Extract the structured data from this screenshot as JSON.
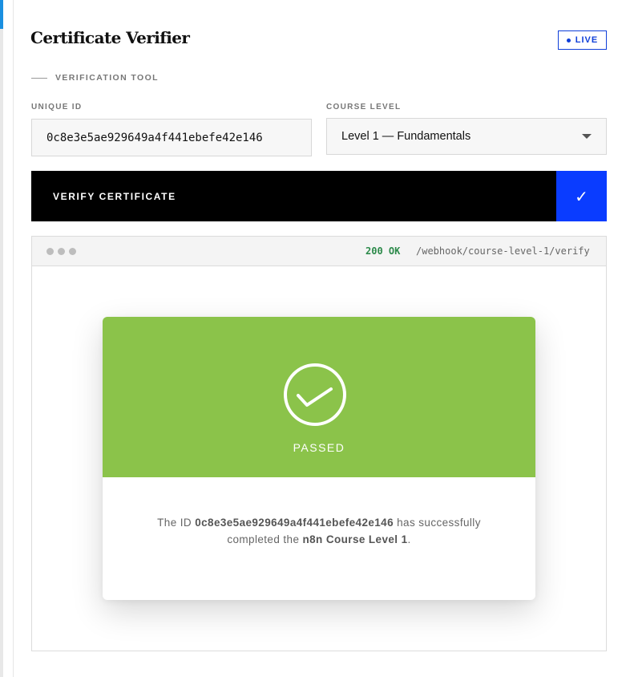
{
  "app": {
    "title": "Certificate Verifier",
    "live_badge": "LIVE",
    "subtitle": "VERIFICATION TOOL"
  },
  "form": {
    "unique_id_label": "UNIQUE ID",
    "unique_id_value": "0c8e3e5ae929649a4f441ebefe42e146",
    "course_level_label": "COURSE LEVEL",
    "course_level_selected": "Level 1 — Fundamentals"
  },
  "actions": {
    "verify_label": "VERIFY CERTIFICATE",
    "verify_icon": "✓"
  },
  "response": {
    "status": "200 OK",
    "endpoint": "/webhook/course-level-1/verify",
    "result": {
      "label": "PASSED",
      "message_prefix": "The ID ",
      "id": "0c8e3e5ae929649a4f441ebefe42e146",
      "message_middle": " has successfully completed the ",
      "course": "n8n Course Level 1",
      "message_suffix": "."
    }
  },
  "colors": {
    "accent_blue": "#0a3cff",
    "success_green": "#8bc34a",
    "status_green": "#2c8a4a"
  }
}
